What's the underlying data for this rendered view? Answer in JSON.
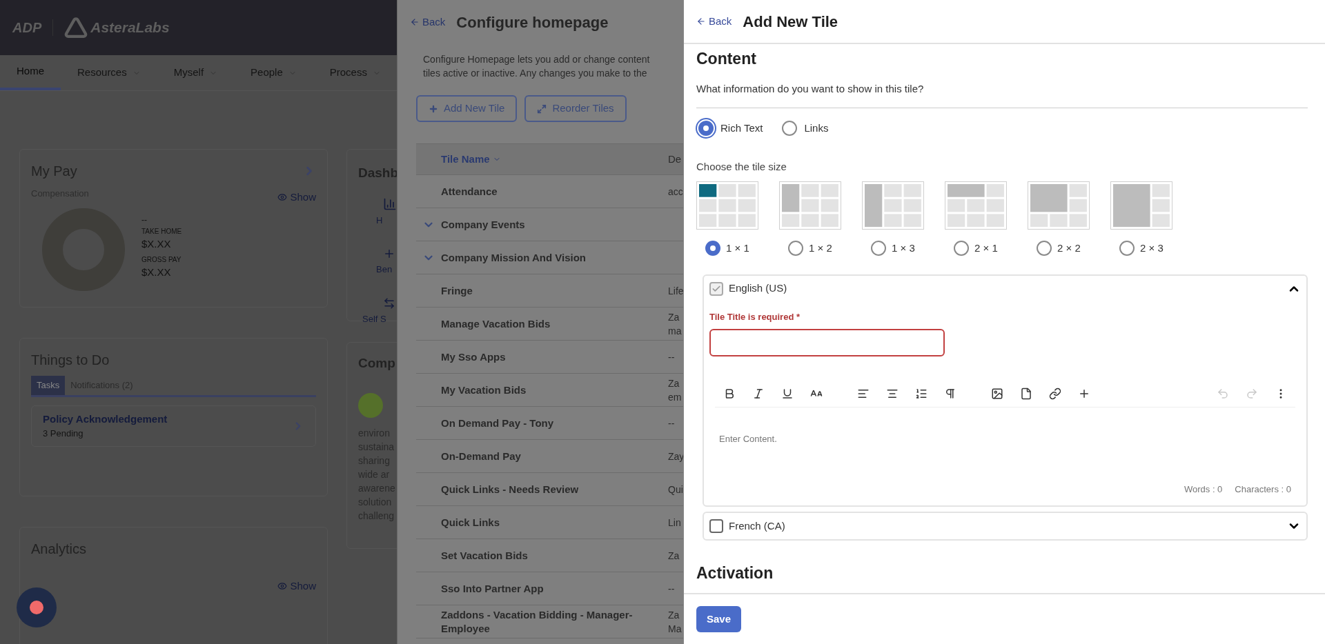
{
  "background_page": {
    "logo": {
      "brand": "ADP",
      "company": "AsteraLabs"
    },
    "nav": [
      {
        "label": "Home",
        "selected": true
      },
      {
        "label": "Resources",
        "selected": false
      },
      {
        "label": "Myself",
        "selected": false
      },
      {
        "label": "People",
        "selected": false
      },
      {
        "label": "Process",
        "selected": false
      }
    ],
    "my_pay": {
      "title": "My Pay",
      "subtitle": "Compensation",
      "show": "Show",
      "value": "--",
      "take_home_label": "TAKE HOME",
      "take_home": "$X.XX",
      "gross_label": "GROSS PAY",
      "gross": "$X.XX"
    },
    "things_to_do": {
      "title": "Things to Do",
      "tabs": [
        {
          "label": "Tasks",
          "selected": true
        },
        {
          "label": "Notifications (2)",
          "selected": false
        }
      ],
      "task": {
        "title": "Policy Acknowledgement",
        "subtitle": "3 Pending"
      }
    },
    "analytics": {
      "title": "Analytics",
      "show": "Show"
    },
    "dashboard": {
      "title": "Dashb",
      "items": [
        "H",
        "Ben",
        "Self S"
      ]
    },
    "company": {
      "title": "Comp",
      "lines": [
        "environ",
        "sustaina",
        "sharing",
        "wide ar",
        "awarene",
        "solution",
        "challeng"
      ]
    }
  },
  "configure_panel": {
    "back": "Back",
    "title": "Configure homepage",
    "description_lines": [
      "Configure Homepage lets you add or change content",
      "tiles active or inactive. Any changes you make to the"
    ],
    "buttons": [
      {
        "label": "Add New Tile",
        "kind": "add"
      },
      {
        "label": "Reorder Tiles",
        "kind": "reorder"
      }
    ],
    "table": {
      "columns": [
        "Tile Name",
        "De"
      ],
      "rows": [
        {
          "name": "Attendance",
          "kind": "tile",
          "description": [
            "acc"
          ]
        },
        {
          "name": "Company Events",
          "kind": "group",
          "description": []
        },
        {
          "name": "Company Mission And Vision",
          "kind": "group",
          "description": []
        },
        {
          "name": "Fringe",
          "kind": "tile",
          "description": [
            "Life"
          ]
        },
        {
          "name": "Manage Vacation Bids",
          "kind": "tile",
          "description": [
            "Za",
            "ma"
          ]
        },
        {
          "name": "My Sso Apps",
          "kind": "tile",
          "description": [
            "--"
          ]
        },
        {
          "name": "My Vacation Bids",
          "kind": "tile",
          "description": [
            "Za",
            "em"
          ]
        },
        {
          "name": "On Demand Pay - Tony",
          "kind": "tile",
          "description": [
            "--"
          ]
        },
        {
          "name": "On-Demand Pay",
          "kind": "tile",
          "description": [
            "Zay"
          ]
        },
        {
          "name": "Quick Links - Needs Review",
          "kind": "tile",
          "description": [
            "Qui"
          ]
        },
        {
          "name": "Quick Links",
          "kind": "tile",
          "description": [
            "Lin"
          ]
        },
        {
          "name": "Set Vacation Bids",
          "kind": "tile",
          "description": [
            "Za"
          ]
        },
        {
          "name": "Sso Into Partner App",
          "kind": "tile",
          "description": [
            "--"
          ]
        },
        {
          "name": "Zaddons - Vacation Bidding - Manager-Employee",
          "kind": "tile",
          "description": [
            "Za",
            "Ma"
          ]
        }
      ]
    }
  },
  "add_tile_panel": {
    "back": "Back",
    "title": "Add New Tile",
    "content": {
      "heading": "Content",
      "question": "What information do you want to show in this tile?",
      "content_types": [
        {
          "label": "Rich Text",
          "selected": true
        },
        {
          "label": "Links",
          "selected": false
        }
      ],
      "size_label": "Choose the tile size",
      "sizes": [
        {
          "label": "1 × 1",
          "selected": true
        },
        {
          "label": "1 × 2",
          "selected": false
        },
        {
          "label": "1 × 3",
          "selected": false
        },
        {
          "label": "2 × 1",
          "selected": false
        },
        {
          "label": "2 × 2",
          "selected": false
        },
        {
          "label": "2 × 3",
          "selected": false
        }
      ],
      "languages": [
        {
          "label": "English (US)",
          "checked": true,
          "expanded": true,
          "error": "Tile Title is required *",
          "editor_placeholder": "Enter Content.",
          "words": "Words : 0",
          "characters": "Characters : 0",
          "toolbar": [
            {
              "disabled": false
            },
            {
              "disabled": false
            },
            {
              "disabled": false
            },
            {
              "disabled": false
            },
            {
              "disabled": false
            },
            {
              "disabled": false
            },
            {
              "disabled": false
            },
            {
              "disabled": false
            },
            {
              "disabled": false
            },
            {
              "disabled": false
            },
            {
              "disabled": false
            },
            {
              "disabled": false
            },
            {
              "disabled": true
            },
            {
              "disabled": true
            },
            {
              "disabled": false
            }
          ]
        },
        {
          "label": "French (CA)",
          "checked": false,
          "expanded": false
        }
      ]
    },
    "activation": {
      "heading": "Activation"
    },
    "save": "Save"
  }
}
